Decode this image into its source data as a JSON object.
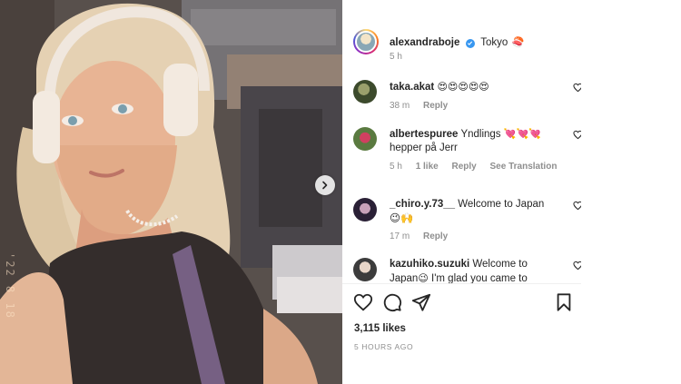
{
  "post": {
    "username": "alexandraboje",
    "caption": "Tokyo",
    "caption_emoji": "🍣",
    "age": "5 h",
    "date_stamp": "'22 8 18",
    "likes": "3,115 likes",
    "timestamp": "5 HOURS AGO"
  },
  "comments": [
    {
      "username": "taka.akat",
      "text": "",
      "emoji": "😍😍😍😍😍",
      "age": "38 m",
      "reply": "Reply",
      "like_count": "",
      "translate": ""
    },
    {
      "username": "albertespuree",
      "text": "Yndlings",
      "emoji": "💘💘💘",
      "text2": "hepper på Jerr",
      "age": "5 h",
      "like_count": "1 like",
      "reply": "Reply",
      "translate": "See Translation"
    },
    {
      "username": "_chiro.y.73__",
      "text": "Welcome to Japan",
      "emoji": "😉🙌",
      "age": "17 m",
      "reply": "Reply",
      "like_count": "",
      "translate": ""
    },
    {
      "username": "kazuhiko.suzuki",
      "text": "Welcome to",
      "text2": "Japan",
      "emoji": "😉",
      "text3": "I'm glad you came to",
      "age": "",
      "reply": "",
      "like_count": "",
      "translate": ""
    }
  ],
  "colors": {
    "verified": "#3897f0",
    "muted": "#8e8e8e",
    "text": "#262626"
  }
}
